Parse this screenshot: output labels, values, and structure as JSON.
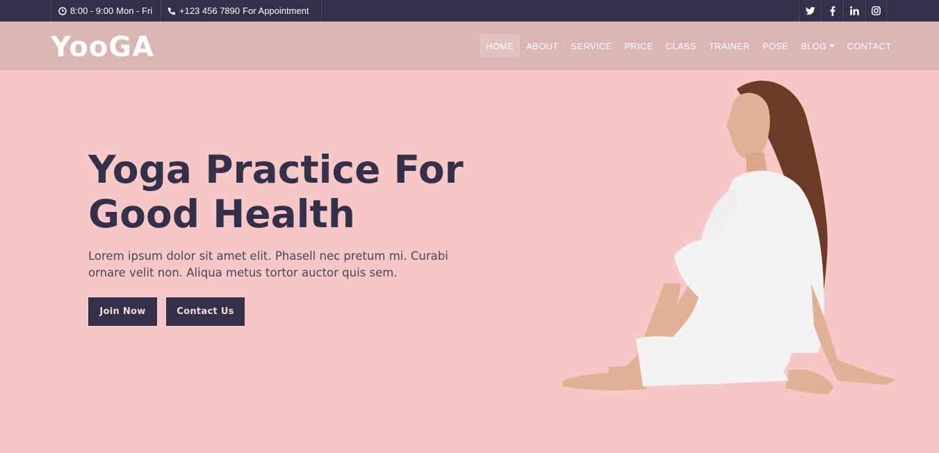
{
  "topbar": {
    "hours": "8:00 - 9:00",
    "days": "Mon - Fri",
    "phone": "+123 456 7890",
    "phone_note": "For Appointment",
    "social": [
      {
        "icon": "twitter-icon",
        "glyph": "🐦"
      },
      {
        "icon": "facebook-icon",
        "glyph": "f"
      },
      {
        "icon": "linkedin-icon",
        "glyph": "in"
      },
      {
        "icon": "instagram-icon",
        "glyph": "◎"
      }
    ]
  },
  "nav": {
    "logo": "YooGA",
    "items": [
      "HOME",
      "ABOUT",
      "SERVICE",
      "PRICE",
      "CLASS",
      "TRAINER",
      "POSE",
      "BLOG",
      "CONTACT"
    ]
  },
  "hero": {
    "title_line1": "Yoga Practice For",
    "title_line2": "Good Health",
    "text": "Lorem ipsum dolor sit amet elit. Phasell nec pretum mi. Curabi ornare velit non. Aliqua metus tortor auctor quis sem.",
    "btn_join": "Join Now",
    "btn_contact": "Contact Us"
  },
  "colors": {
    "topbar_bg": "#353049",
    "nav_bg": "#dbb4b4",
    "hero_bg": "#f7c8c8",
    "accent_dark": "#353049"
  }
}
